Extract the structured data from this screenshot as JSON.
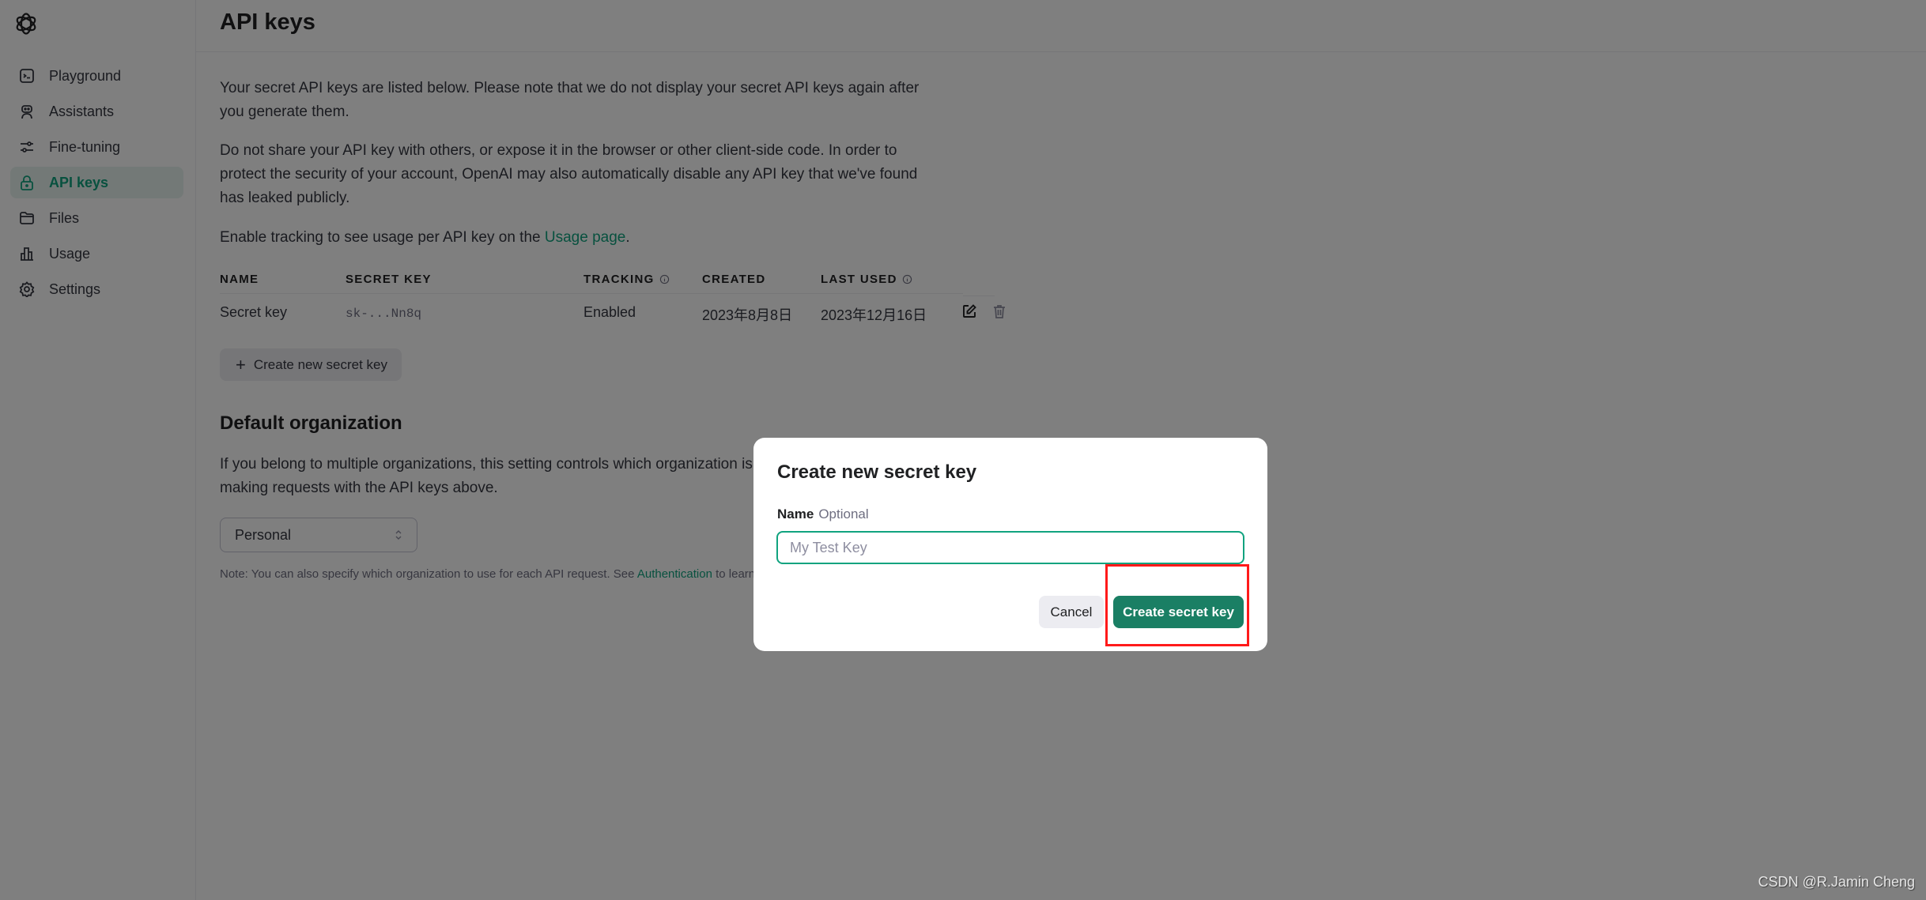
{
  "sidebar": {
    "logo": "openai-logo",
    "items": [
      {
        "label": "Playground",
        "icon": "terminal-icon",
        "active": false
      },
      {
        "label": "Assistants",
        "icon": "robot-icon",
        "active": false
      },
      {
        "label": "Fine-tuning",
        "icon": "sliders-icon",
        "active": false
      },
      {
        "label": "API keys",
        "icon": "lock-icon",
        "active": true
      },
      {
        "label": "Files",
        "icon": "folder-icon",
        "active": false
      },
      {
        "label": "Usage",
        "icon": "bar-chart-icon",
        "active": false
      },
      {
        "label": "Settings",
        "icon": "gear-icon",
        "active": false
      }
    ]
  },
  "header": {
    "title": "API keys"
  },
  "intro": {
    "p1": "Your secret API keys are listed below. Please note that we do not display your secret API keys again after you generate them.",
    "p2": "Do not share your API key with others, or expose it in the browser or other client-side code. In order to protect the security of your account, OpenAI may also automatically disable any API key that we've found has leaked publicly.",
    "p3_prefix": "Enable tracking to see usage per API key on the ",
    "p3_link": "Usage page",
    "p3_suffix": "."
  },
  "table": {
    "columns": [
      "NAME",
      "SECRET KEY",
      "TRACKING",
      "CREATED",
      "LAST USED"
    ],
    "rows": [
      {
        "name": "Secret key",
        "secret_key": "sk-...Nn8q",
        "tracking": "Enabled",
        "created": "2023年8月8日",
        "last_used": "2023年12月16日"
      }
    ]
  },
  "create_new_button": {
    "icon": "plus-icon",
    "label": "Create new secret key"
  },
  "default_org": {
    "title": "Default organization",
    "description": "If you belong to multiple organizations, this setting controls which organization is used by default when making requests with the API keys above.",
    "select_value": "Personal",
    "note_prefix": "Note: You can also specify which organization to use for each API request. See ",
    "note_link": "Authentication",
    "note_suffix": " to learn more."
  },
  "modal": {
    "title": "Create new secret key",
    "field_label": "Name",
    "field_optional": "Optional",
    "input_value": "",
    "input_placeholder": "My Test Key",
    "cancel_label": "Cancel",
    "submit_label": "Create secret key"
  },
  "colors": {
    "accent": "#10a37f",
    "primary_button": "#1a7f64",
    "highlight": "#ff1a1a"
  },
  "watermark": "CSDN @R.Jamin Cheng"
}
